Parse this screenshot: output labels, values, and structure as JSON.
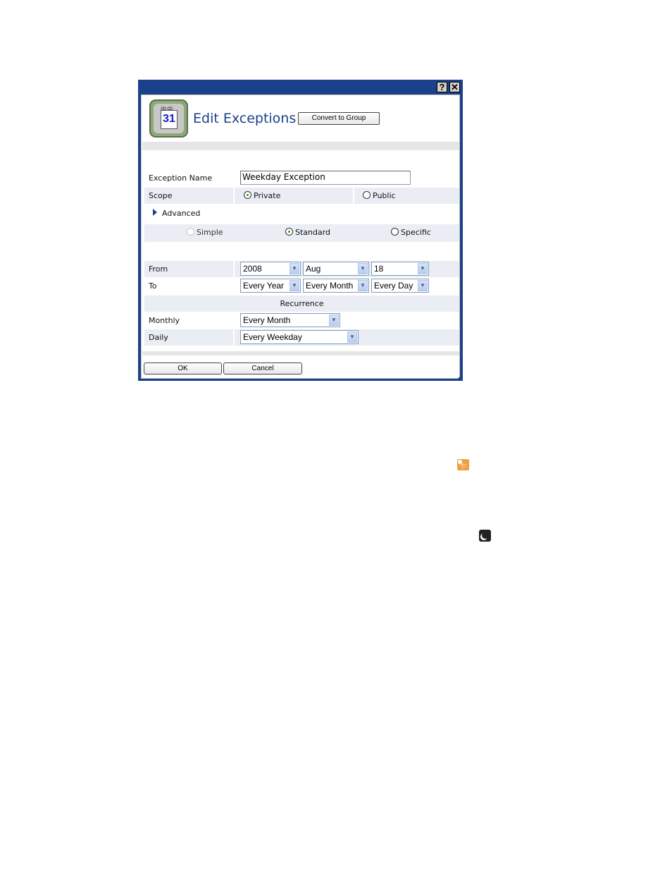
{
  "dialog": {
    "titlebar": {
      "help_label": "?",
      "close_label": "✕"
    },
    "header": {
      "icon": "calendar-icon",
      "icon_day": "31",
      "title": "Edit Exceptions",
      "convert_button": "Convert to Group"
    },
    "form": {
      "exception_name": {
        "label": "Exception Name",
        "value": "Weekday Exception"
      },
      "scope": {
        "label": "Scope",
        "options": [
          {
            "label": "Private",
            "selected": true
          },
          {
            "label": "Public",
            "selected": false
          }
        ]
      },
      "advanced": {
        "label": "Advanced",
        "icon": "triangle-right-icon"
      },
      "mode": {
        "options": [
          {
            "label": "Simple",
            "selected": false,
            "disabled": true
          },
          {
            "label": "Standard",
            "selected": true,
            "disabled": false
          },
          {
            "label": "Specific",
            "selected": false,
            "disabled": false
          }
        ]
      },
      "from": {
        "label": "From",
        "year": "2008",
        "month": "Aug",
        "day": "18"
      },
      "to": {
        "label": "To",
        "year": "Every Year",
        "month": "Every Month",
        "day": "Every Day"
      },
      "recurrence": {
        "header": "Recurrence",
        "monthly": {
          "label": "Monthly",
          "value": "Every Month"
        },
        "daily": {
          "label": "Daily",
          "value": "Every Weekday"
        }
      }
    },
    "footer": {
      "ok_button": "OK",
      "cancel_button": "Cancel"
    }
  },
  "page_icons": {
    "sun": "sun-icon",
    "moon": "moon-icon"
  },
  "colors": {
    "dialog_frame": "#1a4189",
    "title_text": "#1a4189",
    "row_shade": "#eaedf4",
    "band": "#e6e6e6",
    "sun_bg": "#f0a040",
    "moon_bg": "#222222"
  }
}
